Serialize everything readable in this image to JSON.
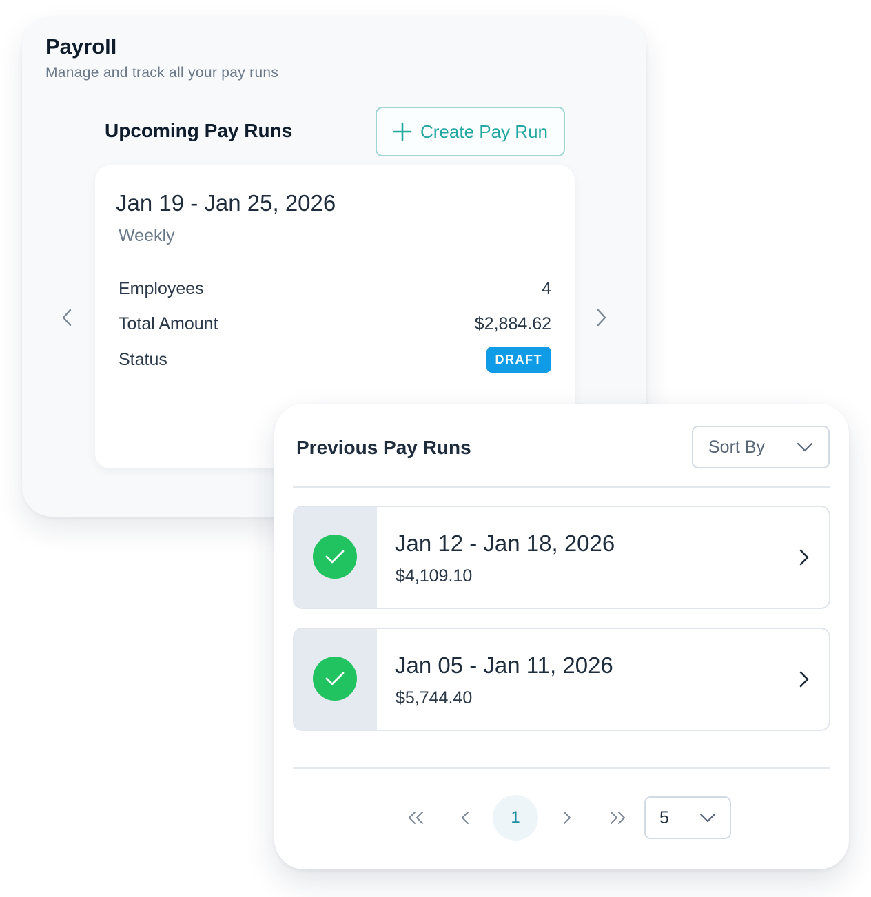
{
  "payroll": {
    "title": "Payroll",
    "subtitle": "Manage and track all your pay runs"
  },
  "upcoming": {
    "title": "Upcoming Pay Runs",
    "create_label": "Create Pay Run",
    "run": {
      "range": "Jan 19 - Jan 25, 2026",
      "frequency": "Weekly",
      "employees_label": "Employees",
      "employees_value": "4",
      "amount_label": "Total Amount",
      "amount_value": "$2,884.62",
      "status_label": "Status",
      "status_value": "DRAFT"
    }
  },
  "previous": {
    "title": "Previous Pay Runs",
    "sort_label": "Sort By",
    "items": [
      {
        "range": "Jan 12 - Jan 18, 2026",
        "amount": "$4,109.10"
      },
      {
        "range": "Jan 05 - Jan 11, 2026",
        "amount": "$5,744.40"
      }
    ],
    "pagination": {
      "current_page": "1",
      "page_size": "5"
    }
  },
  "colors": {
    "accent": "#23a7a0",
    "draft_badge": "#109be6",
    "success": "#21c260"
  }
}
